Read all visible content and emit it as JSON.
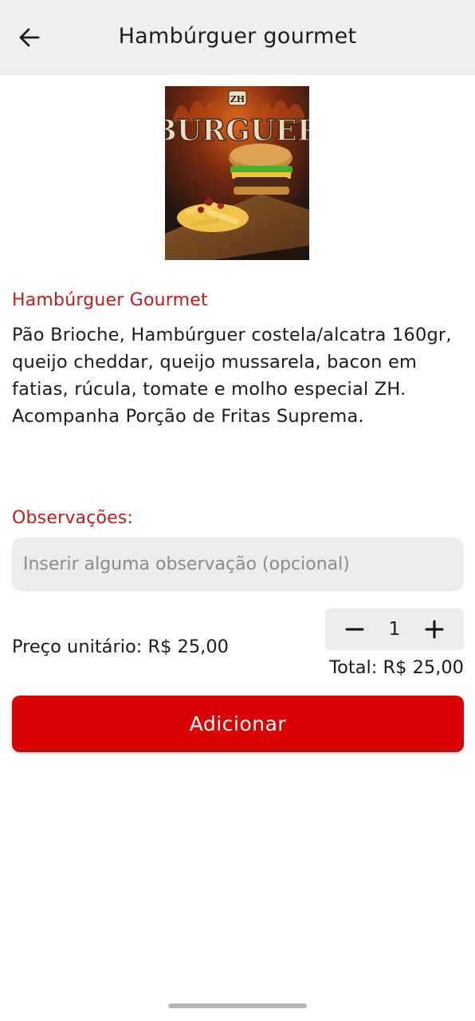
{
  "header": {
    "title": "Hambúrguer gourmet",
    "back_icon": "arrow-left-icon"
  },
  "product": {
    "image_text_brand": "ZH",
    "image_text_title": "BURGUER",
    "name": "Hambúrguer Gourmet",
    "description": "Pão Brioche, Hambúrguer costela/alcatra 160gr, queijo cheddar, queijo mussarela, bacon em fatias, rúcula, tomate e molho especial ZH.\nAcompanha Porção de Fritas Suprema."
  },
  "observations": {
    "label": "Observações:",
    "placeholder": "Inserir alguma observação (opcional)",
    "value": ""
  },
  "pricing": {
    "unit_price": "Preço unitário: R$ 25,00",
    "quantity": "1",
    "total": "Total: R$ 25,00",
    "minus_icon": "minus-icon",
    "plus_icon": "plus-icon"
  },
  "actions": {
    "add_label": "Adicionar"
  },
  "colors": {
    "accent": "#c6191b",
    "button": "#da0303",
    "header_bg": "#efefef",
    "field_bg": "#ececec"
  }
}
